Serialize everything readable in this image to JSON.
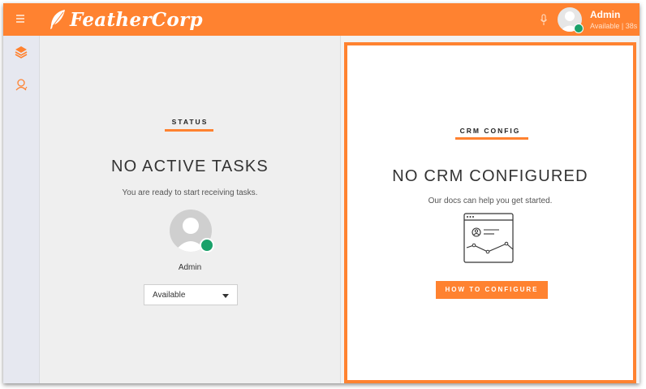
{
  "header": {
    "menu_icon": "hamburger-icon",
    "logo_text": "FeatherCorp",
    "logo_icon": "feather-icon",
    "mic_icon": "microphone-icon",
    "user": {
      "name": "Admin",
      "status_line": "Available | 38s"
    }
  },
  "sidebar": {
    "items": [
      {
        "icon": "layers-icon",
        "active": true
      },
      {
        "icon": "agent-icon",
        "active": false
      }
    ]
  },
  "status_panel": {
    "label": "STATUS",
    "title": "NO ACTIVE TASKS",
    "subtitle": "You are ready to start receiving tasks.",
    "agent_name": "Admin",
    "status_select": {
      "value": "Available"
    }
  },
  "crm_panel": {
    "label": "CRM CONFIG",
    "title": "NO CRM CONFIGURED",
    "subtitle": "Our docs can help you get started.",
    "button_label": "HOW TO CONFIGURE",
    "illustration": "docs-browser-icon"
  },
  "colors": {
    "accent": "#ff8230",
    "available": "#1aa16a",
    "sidebar_bg": "#e6e8f0",
    "pane_bg": "#efefef"
  }
}
